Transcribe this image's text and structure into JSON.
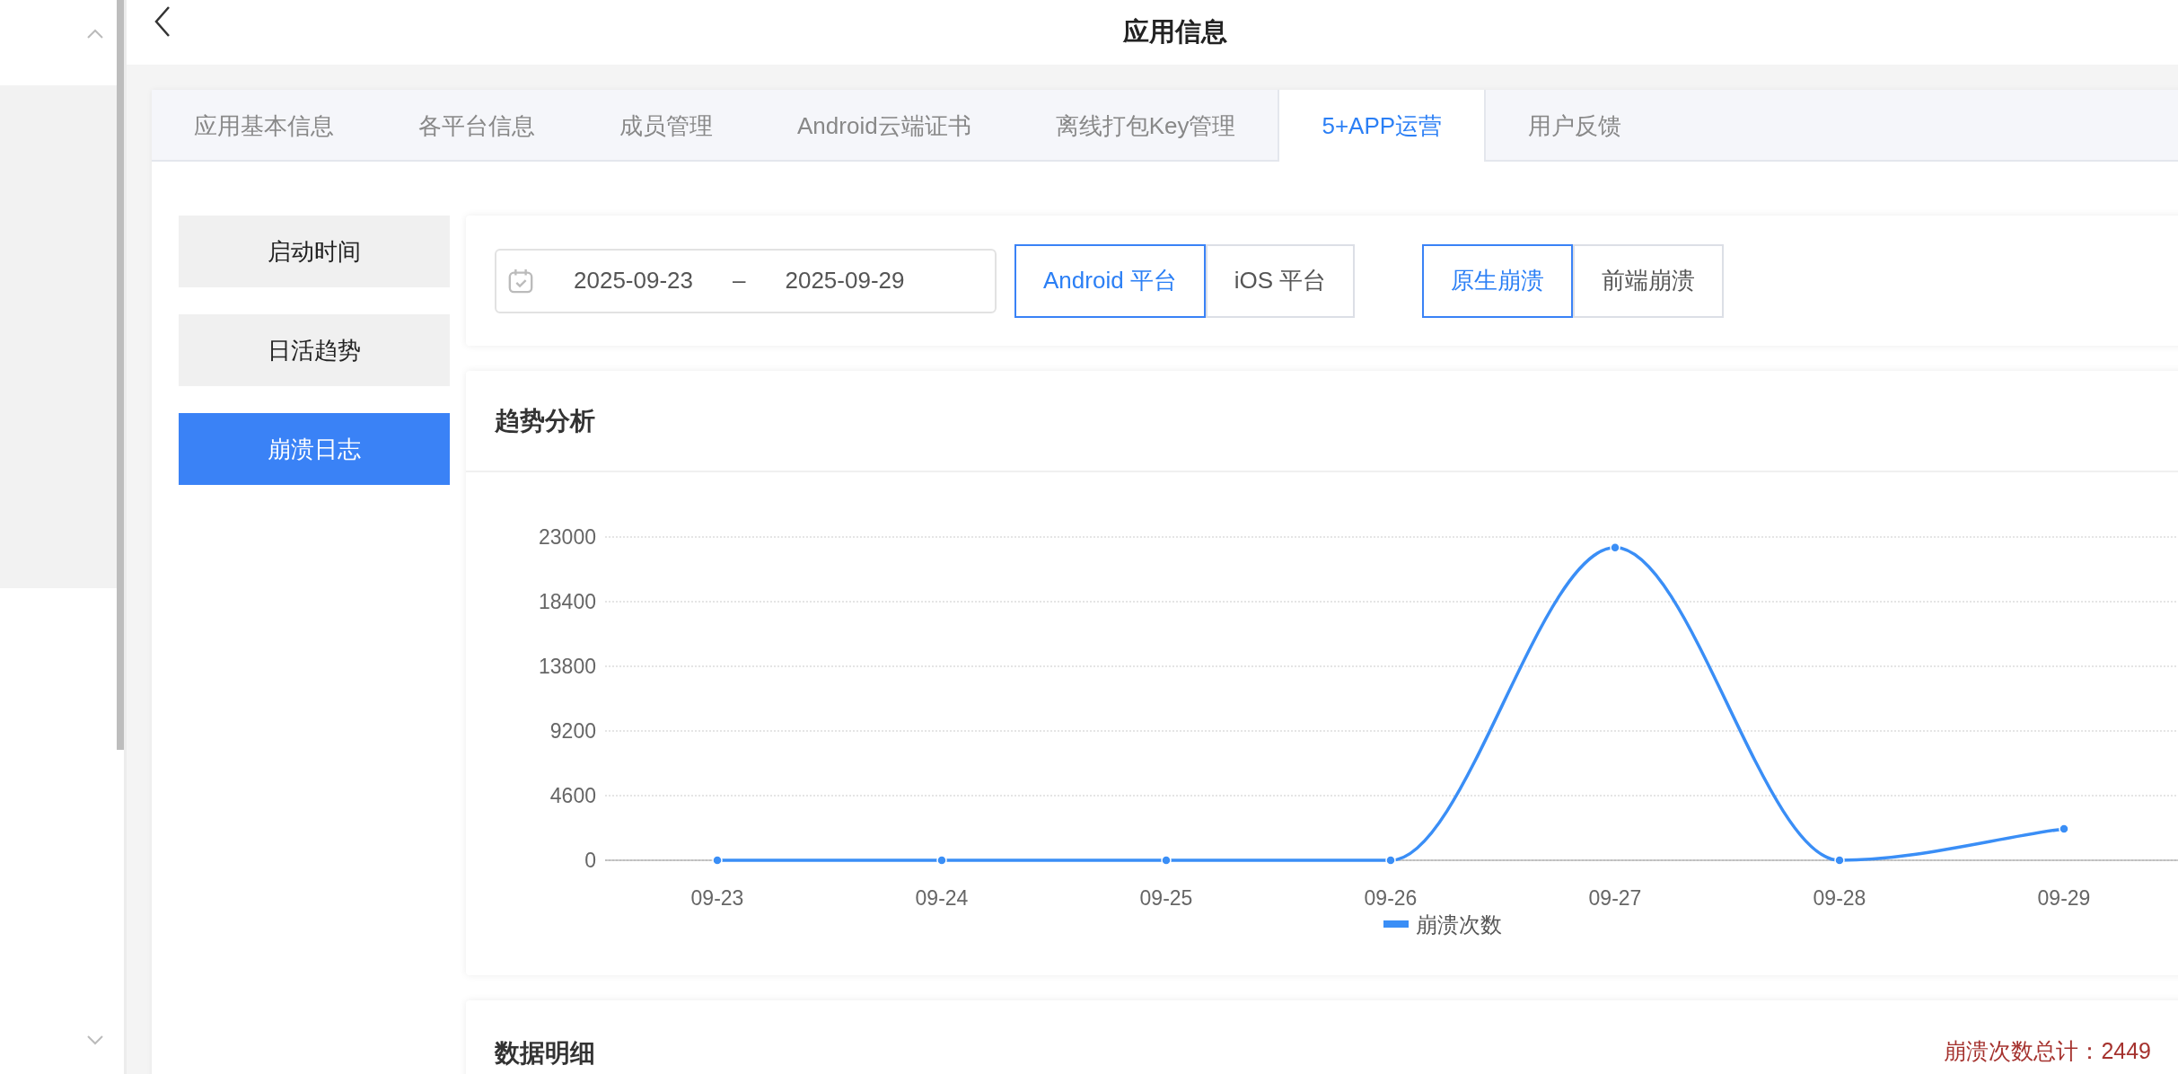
{
  "header": {
    "title": "应用信息"
  },
  "tabs": [
    {
      "label": "应用基本信息",
      "selected": false
    },
    {
      "label": "各平台信息",
      "selected": false
    },
    {
      "label": "成员管理",
      "selected": false
    },
    {
      "label": "Android云端证书",
      "selected": false
    },
    {
      "label": "离线打包Key管理",
      "selected": false
    },
    {
      "label": "5+APP运营",
      "selected": true
    },
    {
      "label": "用户反馈",
      "selected": false
    }
  ],
  "side_menu": [
    {
      "label": "启动时间",
      "selected": false
    },
    {
      "label": "日活趋势",
      "selected": false
    },
    {
      "label": "崩溃日志",
      "selected": true
    }
  ],
  "filters": {
    "date_start": "2025-09-23",
    "date_separator": "–",
    "date_end": "2025-09-29",
    "platforms": [
      {
        "label": "Android 平台",
        "selected": true
      },
      {
        "label": "iOS 平台",
        "selected": false
      }
    ],
    "crash_types": [
      {
        "label": "原生崩溃",
        "selected": true
      },
      {
        "label": "前端崩溃",
        "selected": false
      }
    ]
  },
  "trend": {
    "title": "趋势分析",
    "chart_data": {
      "type": "line",
      "categories": [
        "09-23",
        "09-24",
        "09-25",
        "09-26",
        "09-27",
        "09-28",
        "09-29"
      ],
      "series": [
        {
          "name": "崩溃次数",
          "color": "#3a8ef6",
          "values": [
            0,
            0,
            0,
            0,
            22250,
            0,
            2240
          ]
        }
      ],
      "ylim": [
        0,
        23000
      ],
      "grid": true,
      "marker": true,
      "yticks": [
        0,
        4600,
        9200,
        13800,
        18400,
        23000
      ]
    }
  },
  "details": {
    "title": "数据明细",
    "total": "崩溃次数总计：2449"
  }
}
